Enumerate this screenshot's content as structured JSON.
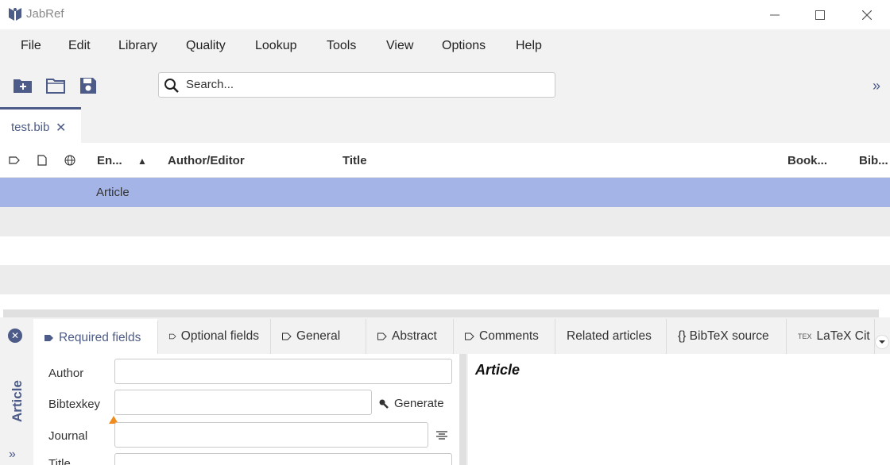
{
  "window": {
    "title": "JabRef"
  },
  "menu": [
    "File",
    "Edit",
    "Library",
    "Quality",
    "Lookup",
    "Tools",
    "View",
    "Options",
    "Help"
  ],
  "toolbar": {
    "search_placeholder": "Search...",
    "more": "»"
  },
  "file_tab": {
    "label": "test.bib",
    "close": "✕"
  },
  "table": {
    "columns": [
      "En...",
      "Author/Editor",
      "Title",
      "Book...",
      "Bib..."
    ],
    "sort_indicator": "▲",
    "rows": [
      {
        "entrytype": "Article",
        "author": "",
        "title": ""
      }
    ]
  },
  "editor": {
    "side_label": "Article",
    "side_expand": "»",
    "tabs": [
      "Required fields",
      "Optional fields",
      "General",
      "Abstract",
      "Comments",
      "Related articles",
      "{} BibTeX source",
      "LaTeX Cit"
    ],
    "fields": {
      "author": "Author",
      "bibtexkey": "Bibtexkey",
      "journal": "Journal",
      "title": "Title"
    },
    "generate_label": "Generate",
    "preview_title": "Article"
  },
  "colors": {
    "accent": "#4c5b87",
    "selected_row": "#a4b4e6",
    "warning": "#f08c1f"
  }
}
